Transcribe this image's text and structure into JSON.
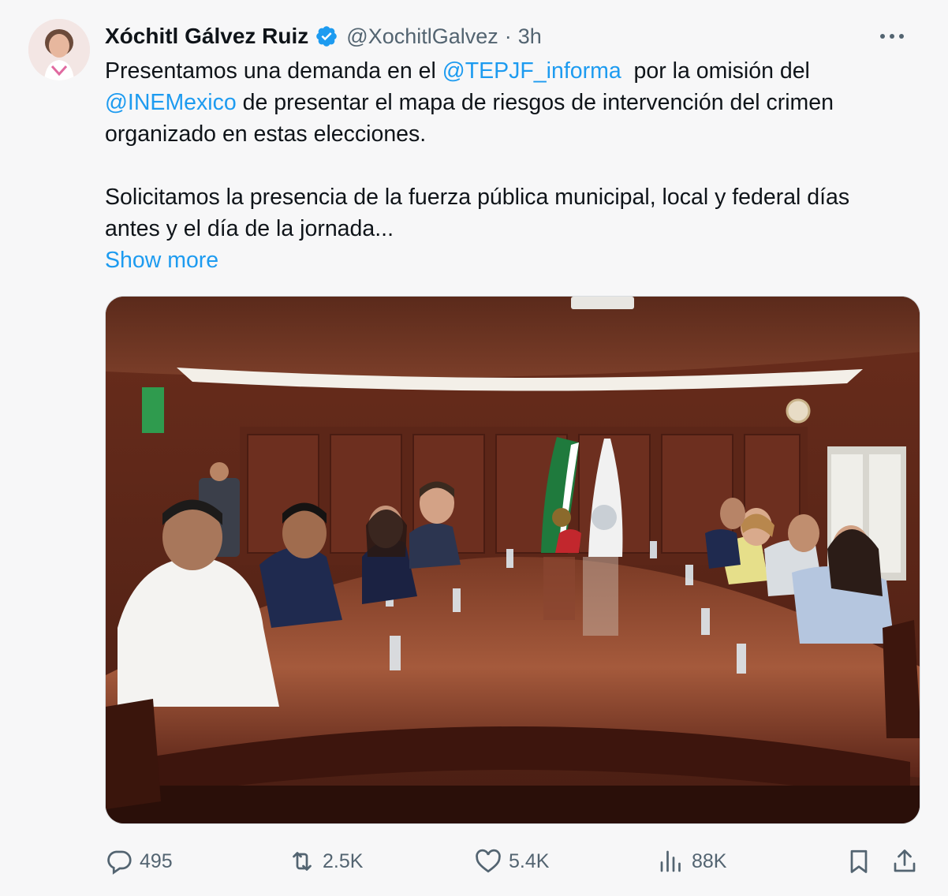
{
  "author": {
    "name": "Xóchitl Gálvez Ruiz",
    "handle": "@XochitlGalvez",
    "separator": "·",
    "time": "3h"
  },
  "icons": {
    "verified": "verified-badge-icon",
    "more": "more-options-icon",
    "reply": "reply-icon",
    "retweet": "retweet-icon",
    "like": "like-icon",
    "views": "views-icon",
    "bookmark": "bookmark-icon",
    "share": "share-icon"
  },
  "tweet": {
    "line1_a": "Presentamos una demanda en el ",
    "mention1": "@TEPJF_informa",
    "line1_b": "  por la omisión del",
    "mention2": "@INEMexico",
    "line2_b": " de presentar el mapa de riesgos de intervención del crimen",
    "line3": "organizado en estas elecciones.",
    "line4": "Solicitamos la presencia de la fuerza pública municipal, local y federal días",
    "line5": "antes y el día de la jornada...",
    "show_more": "Show more"
  },
  "stats": {
    "replies": "495",
    "retweets": "2.5K",
    "likes": "5.4K",
    "views": "88K"
  },
  "colors": {
    "accent": "#1d9bf0",
    "text": "#0f1419",
    "muted": "#536471",
    "background": "#f7f7f8"
  }
}
